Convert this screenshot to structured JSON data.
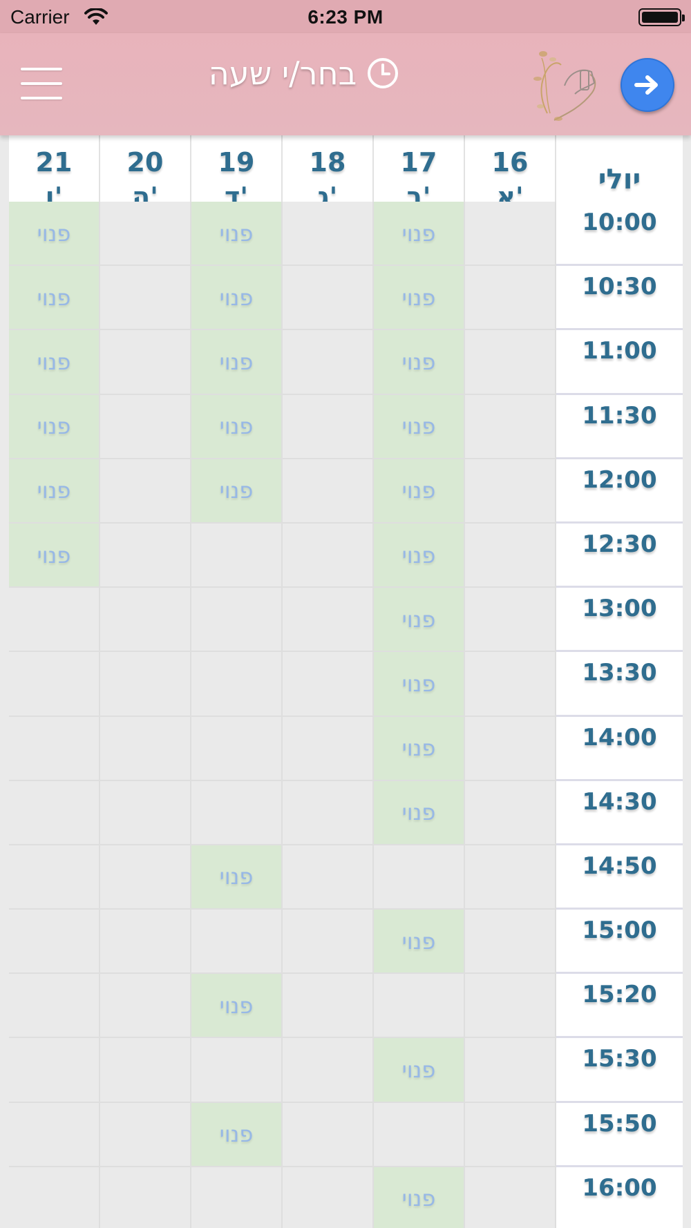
{
  "status_bar": {
    "carrier": "Carrier",
    "time": "6:23 PM"
  },
  "header": {
    "title": "בחר/י שעה",
    "icons": [
      "menu-icon",
      "clock-icon",
      "logo-hand-flowers",
      "arrow-right-icon"
    ]
  },
  "colors": {
    "header": "#e8b3bb",
    "accent": "#3f86ee",
    "free_slot": "#d9e9d3",
    "text": "#2f6d8f"
  },
  "calendar": {
    "month": "יולי",
    "days": [
      {
        "num": "21",
        "name": "ו'"
      },
      {
        "num": "20",
        "name": "ה'"
      },
      {
        "num": "19",
        "name": "ד'"
      },
      {
        "num": "18",
        "name": "ג'"
      },
      {
        "num": "17",
        "name": "ב'"
      },
      {
        "num": "16",
        "name": "א'"
      }
    ],
    "free_label": "פנוי",
    "rows": [
      {
        "time": "10:00",
        "free": [
          true,
          false,
          true,
          false,
          true,
          false
        ]
      },
      {
        "time": "10:30",
        "free": [
          true,
          false,
          true,
          false,
          true,
          false
        ]
      },
      {
        "time": "11:00",
        "free": [
          true,
          false,
          true,
          false,
          true,
          false
        ]
      },
      {
        "time": "11:30",
        "free": [
          true,
          false,
          true,
          false,
          true,
          false
        ]
      },
      {
        "time": "12:00",
        "free": [
          true,
          false,
          true,
          false,
          true,
          false
        ]
      },
      {
        "time": "12:30",
        "free": [
          true,
          false,
          false,
          false,
          true,
          false
        ]
      },
      {
        "time": "13:00",
        "free": [
          false,
          false,
          false,
          false,
          true,
          false
        ]
      },
      {
        "time": "13:30",
        "free": [
          false,
          false,
          false,
          false,
          true,
          false
        ]
      },
      {
        "time": "14:00",
        "free": [
          false,
          false,
          false,
          false,
          true,
          false
        ]
      },
      {
        "time": "14:30",
        "free": [
          false,
          false,
          false,
          false,
          true,
          false
        ]
      },
      {
        "time": "14:50",
        "free": [
          false,
          false,
          true,
          false,
          false,
          false
        ]
      },
      {
        "time": "15:00",
        "free": [
          false,
          false,
          false,
          false,
          true,
          false
        ]
      },
      {
        "time": "15:20",
        "free": [
          false,
          false,
          true,
          false,
          false,
          false
        ]
      },
      {
        "time": "15:30",
        "free": [
          false,
          false,
          false,
          false,
          true,
          false
        ]
      },
      {
        "time": "15:50",
        "free": [
          false,
          false,
          true,
          false,
          false,
          false
        ]
      },
      {
        "time": "16:00",
        "free": [
          false,
          false,
          false,
          false,
          true,
          false
        ]
      }
    ]
  }
}
